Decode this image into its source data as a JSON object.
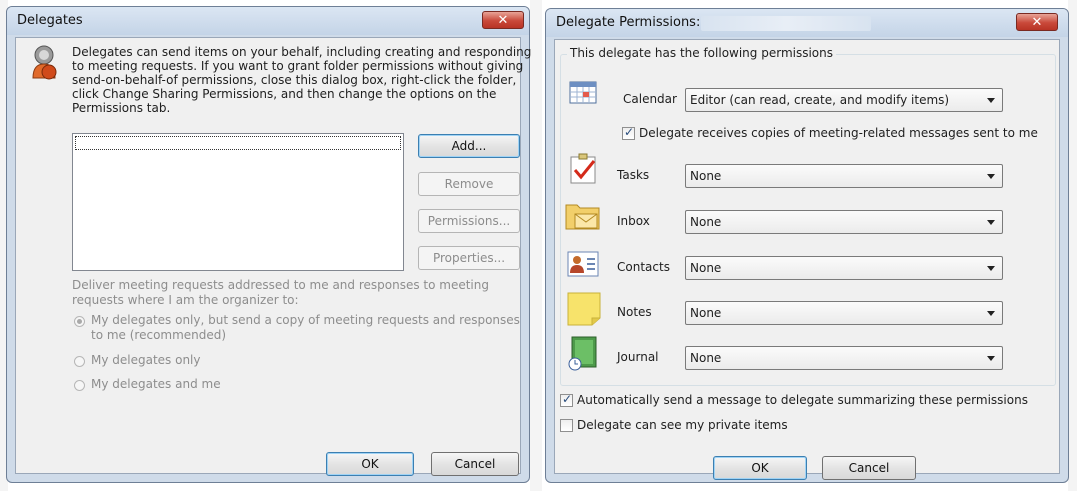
{
  "delegates_dialog": {
    "title": "Delegates",
    "close_glyph": "✕",
    "description": [
      "Delegates can send items on your behalf, including creating and responding",
      "to meeting requests. If you want to grant folder permissions without giving",
      "send-on-behalf-of permissions, close this dialog box, right-click the folder,",
      "click Change Sharing Permissions, and then change the options on the",
      "Permissions tab."
    ],
    "buttons": {
      "add": "Add...",
      "remove": "Remove",
      "permissions": "Permissions...",
      "properties": "Properties..."
    },
    "deliver_text": [
      "Deliver meeting requests addressed to me and responses to meeting",
      "requests where I am the organizer to:"
    ],
    "options": [
      {
        "label_lines": [
          "My delegates only, but send a copy of meeting requests and responses",
          "to me (recommended)"
        ],
        "checked": true
      },
      {
        "label_lines": [
          "My delegates only"
        ],
        "checked": false
      },
      {
        "label_lines": [
          "My delegates and me"
        ],
        "checked": false
      }
    ],
    "ok": "OK",
    "cancel": "Cancel"
  },
  "permissions_dialog": {
    "title": "Delegate Permissions:",
    "close_glyph": "✕",
    "group_label": "This delegate has the following permissions",
    "calendar": {
      "label": "Calendar",
      "value": "Editor (can read, create, and modify items)",
      "icon": "calendar-icon"
    },
    "meeting_copy_label": "Delegate receives copies of meeting-related messages sent to me",
    "meeting_copy_checked": true,
    "folders": [
      {
        "label": "Tasks",
        "value": "None",
        "icon": "tasks-icon"
      },
      {
        "label": "Inbox",
        "value": "None",
        "icon": "inbox-icon"
      },
      {
        "label": "Contacts",
        "value": "None",
        "icon": "contacts-icon"
      },
      {
        "label": "Notes",
        "value": "None",
        "icon": "notes-icon"
      },
      {
        "label": "Journal",
        "value": "None",
        "icon": "journal-icon"
      }
    ],
    "auto_send_label": "Automatically send a message to delegate summarizing these permissions",
    "auto_send_checked": true,
    "private_label": "Delegate can see my private items",
    "private_checked": false,
    "ok": "OK",
    "cancel": "Cancel"
  },
  "colors": {
    "frame": "#cfdbe9",
    "close_button": "#c9493a",
    "disabled_text": "#8d8d8d",
    "focus_border": "#3c7fb1"
  }
}
